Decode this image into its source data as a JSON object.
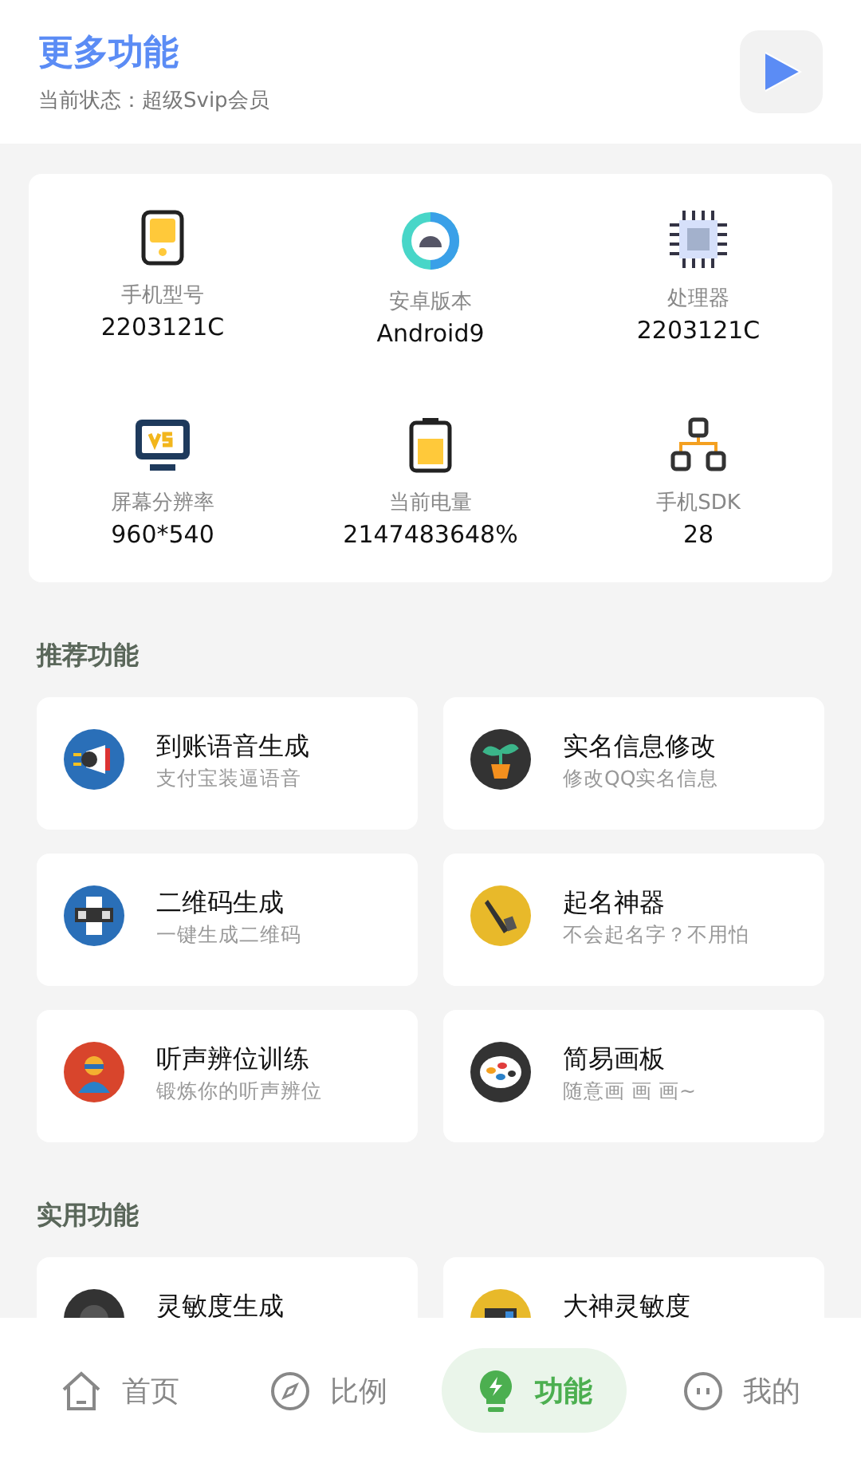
{
  "header": {
    "title": "更多功能",
    "status": "当前状态：超级Svip会员"
  },
  "device_info": [
    {
      "label": "手机型号",
      "value": "2203121C"
    },
    {
      "label": "安卓版本",
      "value": "Android9"
    },
    {
      "label": "处理器",
      "value": "2203121C"
    },
    {
      "label": "屏幕分辨率",
      "value": "960*540"
    },
    {
      "label": "当前电量",
      "value": "2147483648%"
    },
    {
      "label": "手机SDK",
      "value": "28"
    }
  ],
  "sections": [
    {
      "title": "推荐功能",
      "items": [
        {
          "title": "到账语音生成",
          "subtitle": "支付宝装逼语音"
        },
        {
          "title": "实名信息修改",
          "subtitle": "修改QQ实名信息"
        },
        {
          "title": "二维码生成",
          "subtitle": "一键生成二维码"
        },
        {
          "title": "起名神器",
          "subtitle": "不会起名字？不用怕"
        },
        {
          "title": "听声辨位训练",
          "subtitle": "锻炼你的听声辨位"
        },
        {
          "title": "简易画板",
          "subtitle": "随意画 画 画~"
        }
      ]
    },
    {
      "title": "实用功能",
      "items": [
        {
          "title": "灵敏度生成"
        },
        {
          "title": "大神灵敏度"
        }
      ]
    }
  ],
  "bottom_nav": [
    {
      "label": "首页",
      "selected": false
    },
    {
      "label": "比例",
      "selected": false
    },
    {
      "label": "功能",
      "selected": true
    },
    {
      "label": "我的",
      "selected": false
    }
  ]
}
